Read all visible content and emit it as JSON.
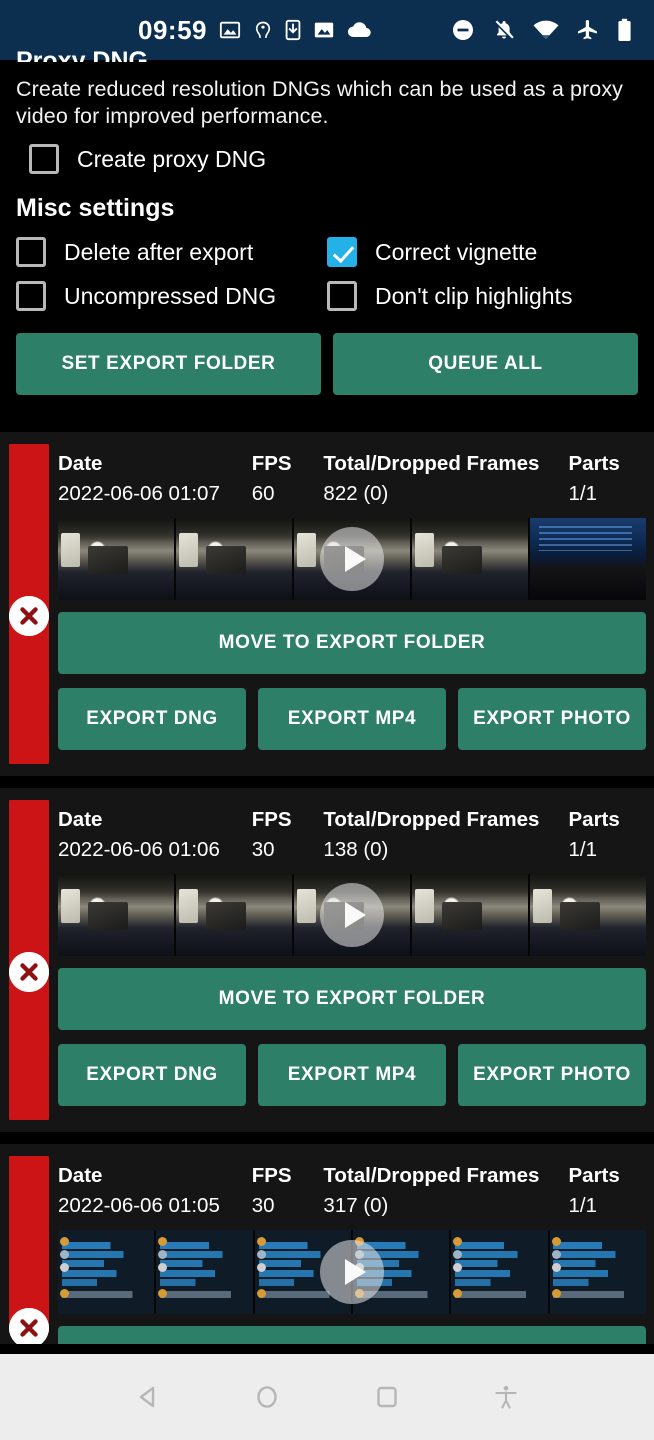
{
  "statusbar": {
    "time": "09:59",
    "left_icons": [
      "gallery-icon",
      "magisk-icon",
      "download-icon",
      "photos-icon",
      "cloud-icon"
    ],
    "right_icons": [
      "do-not-disturb-icon",
      "notifications-silenced-icon",
      "wifi-icon",
      "airplane-mode-icon",
      "battery-icon"
    ],
    "background": "#0c2f4f"
  },
  "settings": {
    "proxy_section_title": "Proxy DNG",
    "proxy_description": "Create reduced resolution DNGs which can be used as a proxy video for improved performance.",
    "proxy_checkbox": {
      "label": "Create proxy DNG",
      "checked": false
    },
    "misc_section_title": "Misc settings",
    "misc_checkboxes": [
      {
        "label": "Delete after export",
        "checked": false
      },
      {
        "label": "Correct vignette",
        "checked": true
      },
      {
        "label": "Uncompressed DNG",
        "checked": false
      },
      {
        "label": "Don't clip highlights",
        "checked": false
      }
    ],
    "buttons": {
      "set_export_folder": "SET EXPORT FOLDER",
      "queue_all": "QUEUE ALL"
    }
  },
  "colors": {
    "accent_green": "#2d7f68",
    "checkbox_checked": "#24b1e8",
    "delete_bar_red": "#cc1417",
    "statusbar_navy": "#0c2f4f",
    "card_background": "#151515"
  },
  "recordings": {
    "column_headers": {
      "date": "Date",
      "fps": "FPS",
      "frames": "Total/Dropped Frames",
      "parts": "Parts"
    },
    "actions": {
      "move": "MOVE TO EXPORT FOLDER",
      "export_dng": "EXPORT DNG",
      "export_mp4": "EXPORT MP4",
      "export_photo": "EXPORT PHOTO",
      "delete": "delete-recording"
    },
    "items": [
      {
        "date": "2022-06-06 01:07",
        "fps": "60",
        "frames": "822 (0)",
        "parts": "1/1",
        "scene": "desk"
      },
      {
        "date": "2022-06-06 01:06",
        "fps": "30",
        "frames": "138 (0)",
        "parts": "1/1",
        "scene": "desk"
      },
      {
        "date": "2022-06-06 01:05",
        "fps": "30",
        "frames": "317 (0)",
        "parts": "1/1",
        "scene": "chat"
      }
    ]
  },
  "navbar": {
    "back": "back-button",
    "home": "home-button",
    "recents": "recents-button",
    "accessibility": "accessibility-button"
  }
}
